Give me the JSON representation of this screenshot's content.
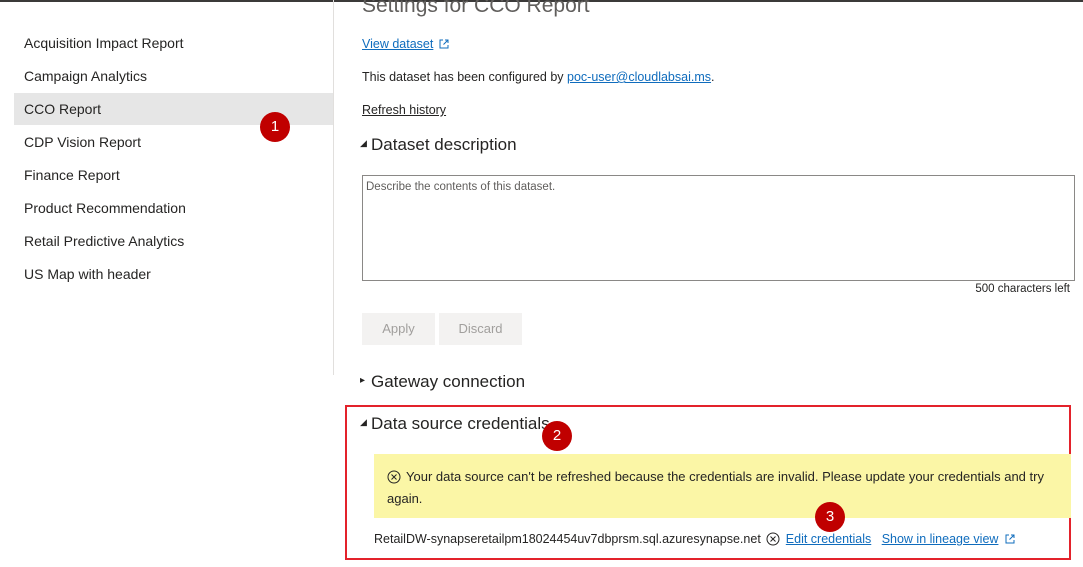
{
  "sidebar": {
    "items": [
      {
        "label": "Acquisition Impact Report",
        "active": false
      },
      {
        "label": "Campaign Analytics",
        "active": false
      },
      {
        "label": "CCO Report",
        "active": true
      },
      {
        "label": "CDP Vision Report",
        "active": false
      },
      {
        "label": "Finance Report",
        "active": false
      },
      {
        "label": "Product Recommendation",
        "active": false
      },
      {
        "label": "Retail Predictive Analytics",
        "active": false
      },
      {
        "label": "US Map with header",
        "active": false
      }
    ]
  },
  "markers": [
    "1",
    "2",
    "3"
  ],
  "main": {
    "title": "Settings for CCO Report",
    "view_dataset_label": "View dataset",
    "configured_prefix": "This dataset has been configured by ",
    "configured_user": "poc-user@cloudlabsai.ms",
    "configured_suffix": ".",
    "refresh_history_label": "Refresh history",
    "dataset_description": {
      "header": "Dataset description",
      "placeholder": "Describe the contents of this dataset.",
      "chars_left": "500 characters left"
    },
    "apply_label": "Apply",
    "discard_label": "Discard",
    "gateway_header": "Gateway connection",
    "credentials": {
      "header": "Data source credentials",
      "warning_text": "Your data source can't be refreshed because the credentials are invalid. Please update your credentials and try again.",
      "datasource_name": "RetailDW-synapseretailpm18024454uv7dbprsm.sql.azuresynapse.net",
      "edit_label": "Edit credentials",
      "lineage_label": "Show in lineage view"
    }
  },
  "colors": {
    "link": "#0f6cbd",
    "marker": "#c00000",
    "highlight_border": "#e3222b",
    "warning_bg": "#fbf6a6",
    "active_nav_bg": "#e6e6e6"
  }
}
